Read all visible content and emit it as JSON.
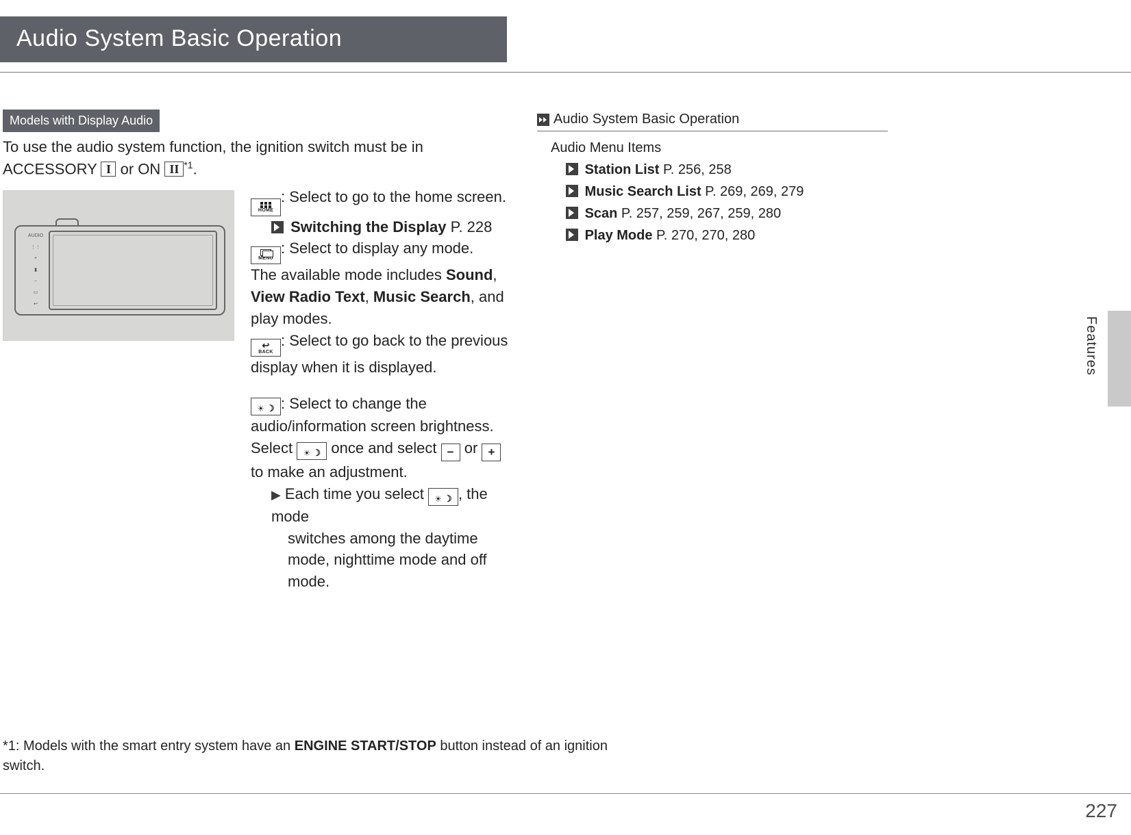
{
  "header": {
    "title": "Audio System Basic Operation"
  },
  "tag": "Models with Display Audio",
  "intro": {
    "pre": "To use the audio system function, the ignition switch must be in ACCESSORY ",
    "key1": "I",
    "mid": " or ON ",
    "key2": "II",
    "sup": "*1",
    "end": "."
  },
  "desc": {
    "home_label": "HOME",
    "home_text": ": Select to go to the home screen.",
    "switching_ref": "Switching the Display",
    "switching_page": " P. 228",
    "menu_label": "MENU",
    "menu_text": ": Select to display any mode.",
    "menu_line2a": "The available mode includes ",
    "menu_bold1": "Sound",
    "menu_sep1": ", ",
    "menu_bold2": "View Radio Text",
    "menu_sep2": ", ",
    "menu_bold3": "Music Search",
    "menu_line2b": ", and play modes.",
    "back_label": "BACK",
    "back_text": ": Select to go back to the previous display when it is displayed.",
    "bright_text": ": Select to change the audio/information screen brightness.",
    "select_pre": "Select ",
    "select_mid": " once and select ",
    "minus": "−",
    "select_or": " or ",
    "plus": "+",
    "select_end": " to make an adjustment.",
    "bullet_pre": "Each time you select ",
    "bullet_end": ", the mode switches among the daytime mode, nighttime mode and off mode."
  },
  "right": {
    "header": "Audio System Basic Operation",
    "list_title": "Audio Menu Items",
    "items": [
      {
        "label": "Station List",
        "pages": " P. 256, 258"
      },
      {
        "label": "Music Search List",
        "pages": " P. 269, 269, 279"
      },
      {
        "label": "Scan",
        "pages": " P. 257, 259, 267, 259, 280"
      },
      {
        "label": "Play Mode",
        "pages": " P. 270, 270, 280"
      }
    ]
  },
  "footnote": {
    "pre": "*1: Models with the smart entry system have an ",
    "bold": "ENGINE START/STOP",
    "post": " button instead of an ignition switch."
  },
  "side_label": "Features",
  "page_num": "227"
}
